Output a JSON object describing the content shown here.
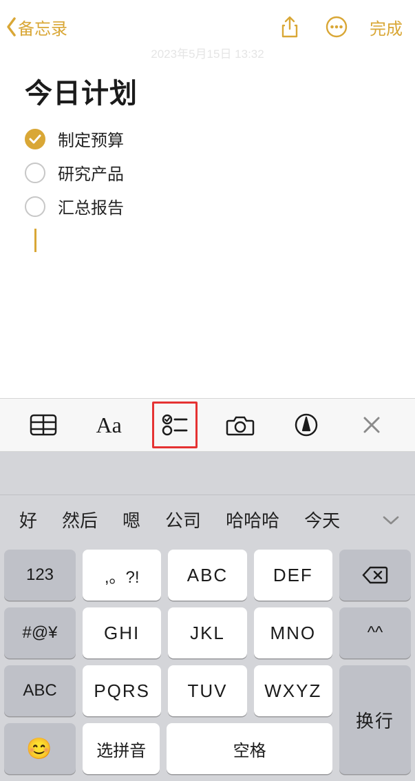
{
  "nav": {
    "back_label": "备忘录",
    "done_label": "完成"
  },
  "meta": {
    "timestamp_faded": "2023年5月15日 13:32"
  },
  "note": {
    "title": "今日计划",
    "checklist": [
      {
        "text": "制定预算",
        "checked": true
      },
      {
        "text": "研究产品",
        "checked": false
      },
      {
        "text": "汇总报告",
        "checked": false
      }
    ]
  },
  "toolbar": {
    "format_label": "Aa",
    "highlighted_tool": "checklist"
  },
  "predictions": [
    "好",
    "然后",
    "嗯",
    "公司",
    "哈哈哈",
    "今天"
  ],
  "keyboard": {
    "rows": [
      [
        "123",
        ",。?!",
        "ABC",
        "DEF"
      ],
      [
        "#@¥",
        "GHI",
        "JKL",
        "MNO"
      ],
      [
        "ABC",
        "PQRS",
        "TUV",
        "WXYZ"
      ]
    ],
    "backspace_icon": "backspace",
    "face_key": "^^",
    "return_label": "换行",
    "select_pinyin": "选拼音",
    "space_label": "空格",
    "emoji": "😊"
  }
}
